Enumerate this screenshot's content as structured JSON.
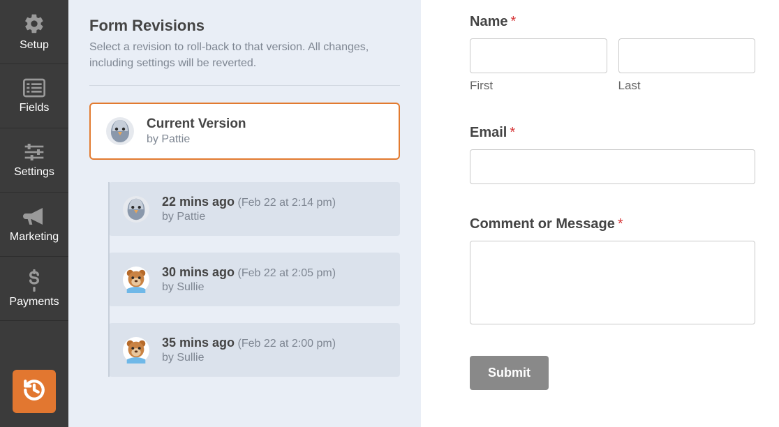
{
  "sidebar": {
    "items": [
      {
        "label": "Setup"
      },
      {
        "label": "Fields"
      },
      {
        "label": "Settings"
      },
      {
        "label": "Marketing"
      },
      {
        "label": "Payments"
      }
    ]
  },
  "revisions": {
    "title": "Form Revisions",
    "description": "Select a revision to roll-back to that version. All changes, including settings will be reverted.",
    "current": {
      "title": "Current Version",
      "by": "by Pattie",
      "avatar": "pigeon"
    },
    "history": [
      {
        "time": "22 mins ago",
        "date": "(Feb 22 at 2:14 pm)",
        "by": "by Pattie",
        "avatar": "pigeon"
      },
      {
        "time": "30 mins ago",
        "date": "(Feb 22 at 2:05 pm)",
        "by": "by Sullie",
        "avatar": "bear"
      },
      {
        "time": "35 mins ago",
        "date": "(Feb 22 at 2:00 pm)",
        "by": "by Sullie",
        "avatar": "bear"
      }
    ]
  },
  "form": {
    "name_label": "Name",
    "first_label": "First",
    "last_label": "Last",
    "email_label": "Email",
    "comment_label": "Comment or Message",
    "submit_label": "Submit",
    "required_mark": "*"
  }
}
